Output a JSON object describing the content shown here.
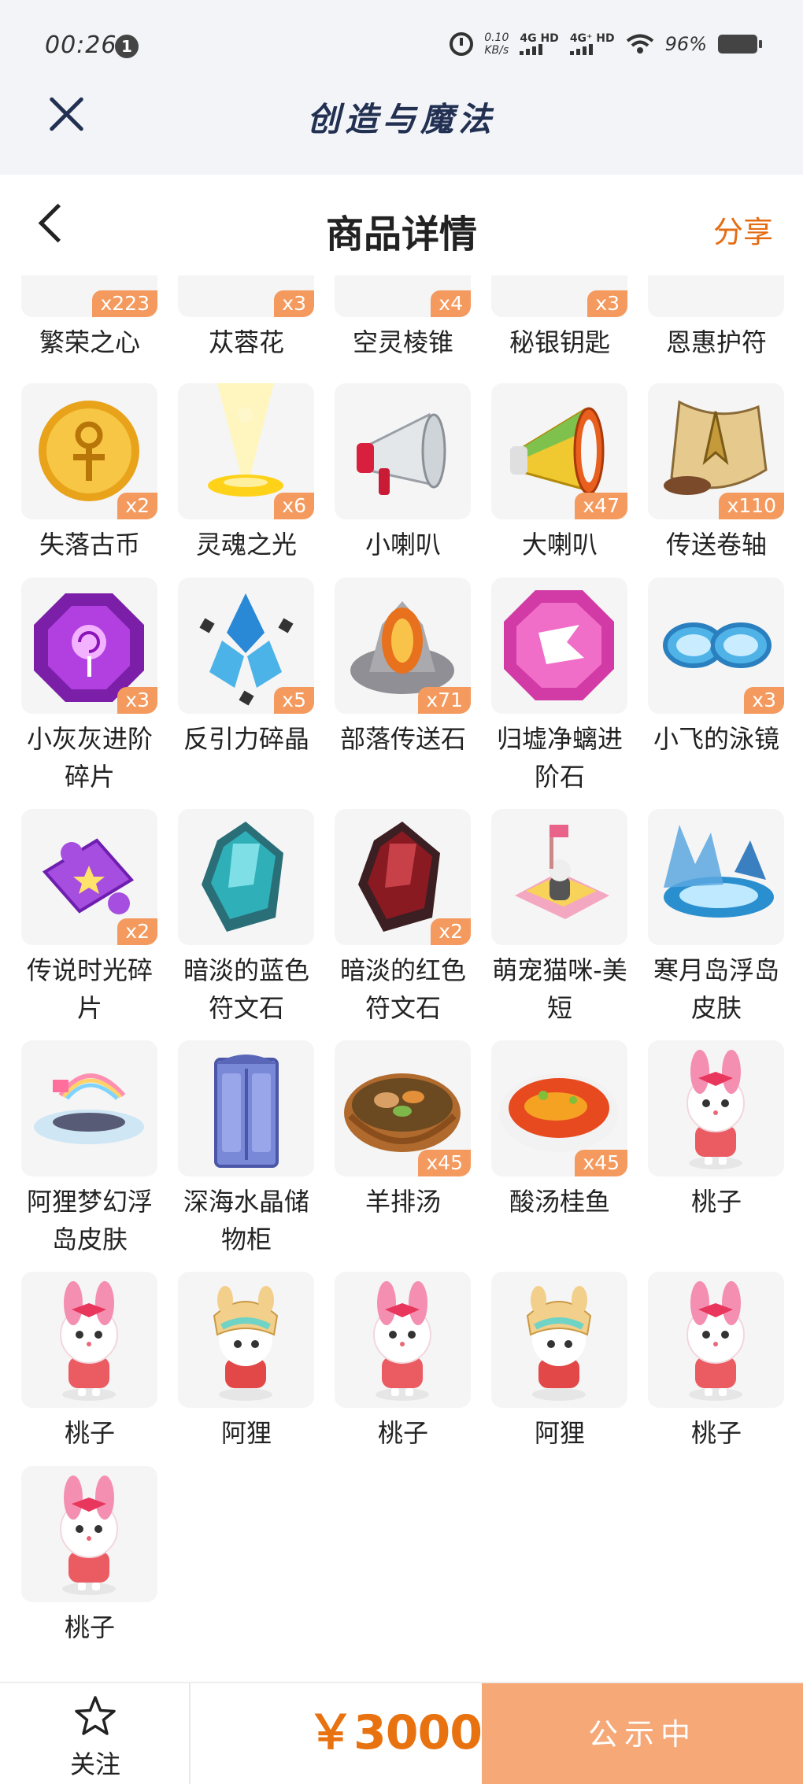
{
  "status_bar": {
    "time": "00:26",
    "notification_count": "1",
    "speed_value": "0.10",
    "speed_unit": "KB/s",
    "network_1": "4G HD",
    "network_2": "4G⁺ HD",
    "battery": "96%"
  },
  "app": {
    "title": "创造与魔法"
  },
  "navbar": {
    "title": "商品详情",
    "share": "分享"
  },
  "items": [
    {
      "name": "繁荣之心",
      "qty": "x223",
      "art": "pinkorb"
    },
    {
      "name": "苁蓉花",
      "qty": "x3",
      "art": "flower"
    },
    {
      "name": "空灵棱锥",
      "qty": "x4",
      "art": "pyramid"
    },
    {
      "name": "秘银钥匙",
      "qty": "x3",
      "art": "key"
    },
    {
      "name": "恩惠护符",
      "qty": "",
      "art": "amulet"
    },
    {
      "name": "失落古币",
      "qty": "x2",
      "art": "coin"
    },
    {
      "name": "灵魂之光",
      "qty": "x6",
      "art": "light"
    },
    {
      "name": "小喇叭",
      "qty": "",
      "art": "horn-small"
    },
    {
      "name": "大喇叭",
      "qty": "x47",
      "art": "horn-big"
    },
    {
      "name": "传送卷轴",
      "qty": "x110",
      "art": "scroll"
    },
    {
      "name": "小灰灰进阶碎片",
      "qty": "x3",
      "art": "gem-purple"
    },
    {
      "name": "反引力碎晶",
      "qty": "x5",
      "art": "crystal-blue"
    },
    {
      "name": "部落传送石",
      "qty": "x71",
      "art": "stone"
    },
    {
      "name": "归墟净螭进阶石",
      "qty": "",
      "art": "gem-pink"
    },
    {
      "name": "小飞的泳镜",
      "qty": "x3",
      "art": "goggles"
    },
    {
      "name": "传说时光碎片",
      "qty": "x2",
      "art": "puzzle"
    },
    {
      "name": "暗淡的蓝色符文石",
      "qty": "",
      "art": "rune-blue"
    },
    {
      "name": "暗淡的红色符文石",
      "qty": "x2",
      "art": "rune-red"
    },
    {
      "name": "萌宠猫咪-美短",
      "qty": "",
      "art": "cat"
    },
    {
      "name": "寒月岛浮岛皮肤",
      "qty": "",
      "art": "island-ice"
    },
    {
      "name": "阿狸梦幻浮岛皮肤",
      "qty": "",
      "art": "island-dream"
    },
    {
      "name": "深海水晶储物柜",
      "qty": "",
      "art": "cabinet"
    },
    {
      "name": "羊排汤",
      "qty": "x45",
      "art": "soup"
    },
    {
      "name": "酸汤桂鱼",
      "qty": "x45",
      "art": "fish"
    },
    {
      "name": "桃子",
      "qty": "",
      "art": "taozi"
    },
    {
      "name": "桃子",
      "qty": "",
      "art": "taozi"
    },
    {
      "name": "阿狸",
      "qty": "",
      "art": "ali"
    },
    {
      "name": "桃子",
      "qty": "",
      "art": "taozi"
    },
    {
      "name": "阿狸",
      "qty": "",
      "art": "ali"
    },
    {
      "name": "桃子",
      "qty": "",
      "art": "taozi"
    },
    {
      "name": "桃子",
      "qty": "",
      "art": "taozi"
    }
  ],
  "bottom": {
    "follow": "关注",
    "price": "￥3000",
    "action": "公示中"
  },
  "colors": {
    "accent": "#e8720f",
    "badge": "#f49a5e",
    "action_button": "#f6a877",
    "header_bg": "#f2f4f8"
  }
}
